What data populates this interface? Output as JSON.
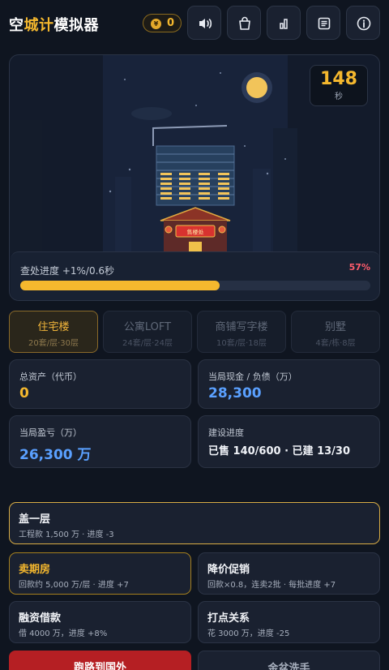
{
  "header": {
    "title_prefix": "空",
    "title_highlight": "城计",
    "title_suffix": "模拟器",
    "coin_symbol": "¥",
    "coins": "0",
    "icons": [
      "volume-icon",
      "shop-bag-icon",
      "stats-chart-icon",
      "notes-icon",
      "info-icon"
    ]
  },
  "scene": {
    "timer_value": "148",
    "timer_unit": "秒",
    "sign_text": "售楼处",
    "progress_label": "查处进度 +1%/0.6秒",
    "progress_percent": "57%",
    "progress_fraction": 0.57,
    "colors": {
      "accent": "#f5b82e",
      "danger": "#ff5c6c",
      "sky": "#131b2b"
    }
  },
  "tabs": [
    {
      "name": "住宅楼",
      "sub": "20套/层·30层",
      "active": true
    },
    {
      "name": "公寓LOFT",
      "sub": "24套/层·24层",
      "active": false
    },
    {
      "name": "商铺写字楼",
      "sub": "10套/层·18层",
      "active": false
    },
    {
      "name": "别墅",
      "sub": "4套/栋·8层",
      "active": false
    }
  ],
  "stats": {
    "assets_label": "总资产（代币）",
    "assets_value": "0",
    "cash_label": "当局现金 / 负债（万）",
    "cash_value": "28,300",
    "pnl_label": "当局盈亏（万）",
    "pnl_value": "26,300 万",
    "build_label": "建设进度",
    "build_value": "已售 140/600 · 已建 13/30"
  },
  "actions": {
    "build_floor": {
      "name": "盖一层",
      "desc": "工程款 1,500 万 · 进度 -3"
    },
    "presale": {
      "name": "卖期房",
      "desc": "回款约 5,000 万/层 · 进度 +7"
    },
    "discount": {
      "name": "降价促销",
      "desc": "回款×0.8，连卖2批 · 每批进度 +7"
    },
    "loan": {
      "name": "融资借款",
      "desc": "借 4000 万，进度 +8%"
    },
    "bribe": {
      "name": "打点关系",
      "desc": "花 3000 万，进度 -25"
    },
    "flee": {
      "name": "跑路到国外"
    },
    "washhands": {
      "name": "金盆洗手"
    }
  }
}
